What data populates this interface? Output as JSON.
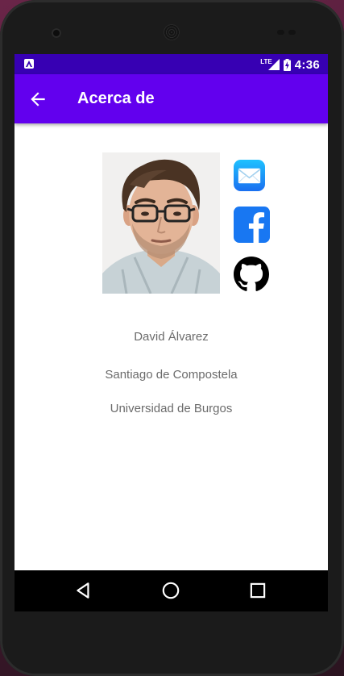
{
  "status_bar": {
    "network_label": "LTE",
    "time": "4:36"
  },
  "app_bar": {
    "title": "Acerca de",
    "back_icon": "arrow-back-icon"
  },
  "profile": {
    "photo_alt": "profile-photo",
    "name": "David Álvarez",
    "city": "Santiago de Compostela",
    "university": "Universidad de Burgos"
  },
  "social_links": [
    {
      "icon": "mail-icon",
      "color": "#1fa3ff"
    },
    {
      "icon": "facebook-icon",
      "color": "#1877f2"
    },
    {
      "icon": "github-icon",
      "color": "#000000"
    }
  ],
  "nav_bar": {
    "back": "triangle-back-icon",
    "home": "circle-home-icon",
    "recents": "square-recents-icon"
  },
  "colors": {
    "status_bar": "#3700b3",
    "app_bar": "#6200ee",
    "text": "#6b6b6b"
  }
}
